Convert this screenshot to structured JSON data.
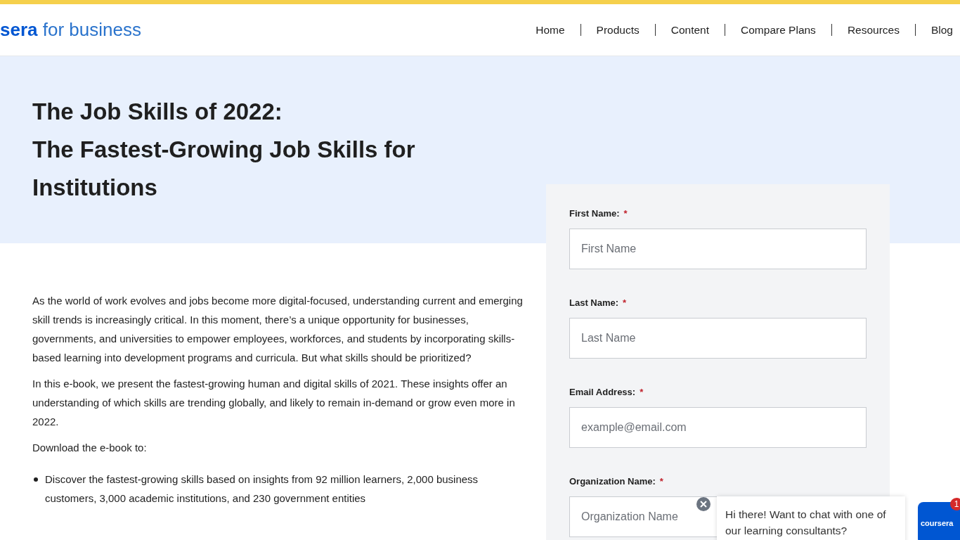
{
  "header": {
    "logo": {
      "brand": "sera",
      "suffix": "for business"
    },
    "nav": [
      {
        "label": "Home"
      },
      {
        "label": "Products"
      },
      {
        "label": "Content"
      },
      {
        "label": "Compare Plans"
      },
      {
        "label": "Resources"
      },
      {
        "label": "Blog"
      }
    ]
  },
  "hero": {
    "title_lines": [
      "The Job Skills of 2022:",
      "The Fastest-Growing Job Skills for",
      "Institutions"
    ]
  },
  "body": {
    "paragraphs": [
      "As the world of work evolves and jobs become more digital-focused, understanding current and emerging skill trends is increasingly critical. In this moment, there’s a unique opportunity for businesses, governments, and universities to empower employees, workforces, and students by incorporating skills-based learning into development programs and curricula. But what skills should be prioritized?",
      "In this e-book, we present the fastest-growing human and digital skills of 2021. These insights offer an understanding of which skills are trending globally, and likely to remain in-demand or grow even more in 2022.",
      "Download the e-book to:"
    ],
    "bullets": [
      "Discover the fastest-growing skills based on insights from 92 million learners, 2,000 business customers, 3,000 academic institutions, and 230 government entities"
    ]
  },
  "form": {
    "fields": [
      {
        "label": "First Name:",
        "required_mark": "*",
        "placeholder": "First Name"
      },
      {
        "label": "Last Name:",
        "required_mark": "*",
        "placeholder": "Last Name"
      },
      {
        "label": "Email Address:",
        "required_mark": "*",
        "placeholder": "example@email.com"
      },
      {
        "label": "Organization Name:",
        "required_mark": "*",
        "placeholder": "Organization Name"
      }
    ]
  },
  "chat": {
    "message": "Hi there! Want to chat with one of our learning consultants?",
    "launcher_label": "coursera",
    "badge": "1"
  }
}
